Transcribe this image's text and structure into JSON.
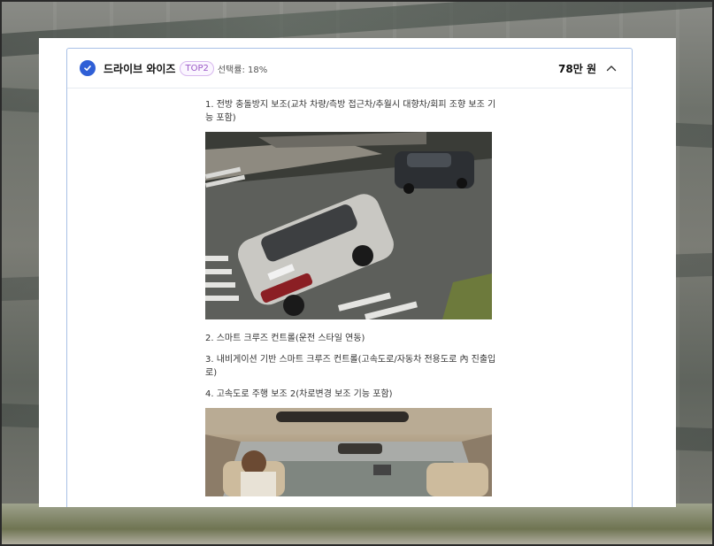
{
  "option": {
    "title": "드라이브 와이즈",
    "badge": "TOP2",
    "selection_rate": "선택률: 18%",
    "price": "78만 원",
    "expanded": true
  },
  "features": [
    {
      "text": "1. 전방 충돌방지 보조(교차 차량/측방 접근차/추월시 대향차/회피 조향 보조 기능 포함)"
    },
    {
      "text": "2. 스마트 크루즈 컨트롤(운전 스타일 연동)"
    },
    {
      "text": "3. 내비게이션 기반 스마트 크루즈 컨트롤(고속도로/자동차 전용도로 內 진출입로)"
    },
    {
      "text": "4. 고속도로 주행 보조 2(차로변경 보조 기능 포함)"
    }
  ],
  "images": [
    {
      "name": "silver minivan driving through crosswalk, aerial view"
    },
    {
      "name": "car interior view from rear seats showing highway"
    }
  ],
  "colors": {
    "accent": "#2f5fd6",
    "badge": "#9b59c7",
    "card_border": "#a9c1e6"
  }
}
